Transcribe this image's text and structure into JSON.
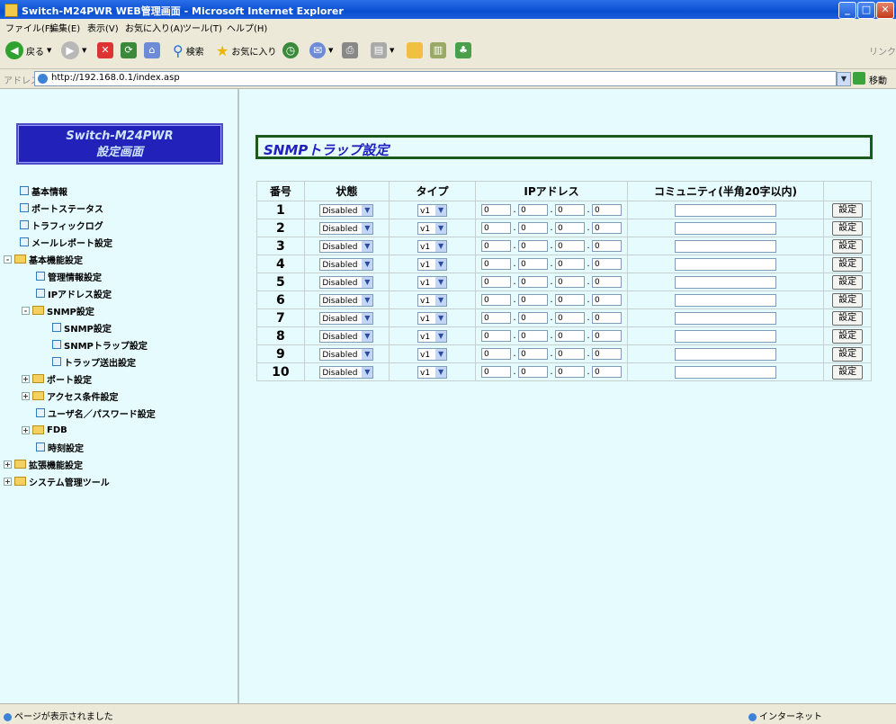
{
  "window": {
    "title": "Switch-M24PWR WEB管理画面 - Microsoft Internet Explorer",
    "minimize": "_",
    "maximize": "□",
    "close": "✕"
  },
  "menu": [
    "ファイル(F)",
    "編集(E)",
    "表示(V)",
    "お気に入り(A)",
    "ツール(T)",
    "ヘルプ(H)"
  ],
  "toolbar": {
    "back": "戻る",
    "search": "検索",
    "favorites": "お気に入り",
    "links": "リンク"
  },
  "address": {
    "label": "アドレス(D)",
    "url": "http://192.168.0.1/index.asp",
    "go": "移動"
  },
  "sidebar": {
    "logo_line1": "Switch-M24PWR",
    "logo_line2": "設定画面",
    "items": [
      {
        "label": "基本情報"
      },
      {
        "label": "ポートステータス"
      },
      {
        "label": "トラフィックログ"
      },
      {
        "label": "メールレポート設定"
      },
      {
        "label": "基本機能設定",
        "toggle": "-"
      },
      {
        "label": "管理情報設定"
      },
      {
        "label": "IPアドレス設定"
      },
      {
        "label": "SNMP設定",
        "toggle": "-"
      },
      {
        "label": "SNMP設定"
      },
      {
        "label": "SNMPトラップ設定"
      },
      {
        "label": "トラップ送出設定"
      },
      {
        "label": "ポート設定",
        "toggle": "+"
      },
      {
        "label": "アクセス条件設定",
        "toggle": "+"
      },
      {
        "label": "ユーザ名／パスワード設定"
      },
      {
        "label": "FDB",
        "toggle": "+"
      },
      {
        "label": "時刻設定"
      },
      {
        "label": "拡張機能設定",
        "toggle": "+"
      },
      {
        "label": "システム管理ツール",
        "toggle": "+"
      }
    ]
  },
  "page": {
    "title": "SNMPトラップ設定",
    "headers": [
      "番号",
      "状態",
      "タイプ",
      "IPアドレス",
      "コミュニティ(半角20字以内)"
    ],
    "rows": [
      {
        "no": "1",
        "status": "Disabled",
        "type": "v1",
        "ip": [
          "0",
          "0",
          "0",
          "0"
        ],
        "community": "",
        "button": "設定"
      },
      {
        "no": "2",
        "status": "Disabled",
        "type": "v1",
        "ip": [
          "0",
          "0",
          "0",
          "0"
        ],
        "community": "",
        "button": "設定"
      },
      {
        "no": "3",
        "status": "Disabled",
        "type": "v1",
        "ip": [
          "0",
          "0",
          "0",
          "0"
        ],
        "community": "",
        "button": "設定"
      },
      {
        "no": "4",
        "status": "Disabled",
        "type": "v1",
        "ip": [
          "0",
          "0",
          "0",
          "0"
        ],
        "community": "",
        "button": "設定"
      },
      {
        "no": "5",
        "status": "Disabled",
        "type": "v1",
        "ip": [
          "0",
          "0",
          "0",
          "0"
        ],
        "community": "",
        "button": "設定"
      },
      {
        "no": "6",
        "status": "Disabled",
        "type": "v1",
        "ip": [
          "0",
          "0",
          "0",
          "0"
        ],
        "community": "",
        "button": "設定"
      },
      {
        "no": "7",
        "status": "Disabled",
        "type": "v1",
        "ip": [
          "0",
          "0",
          "0",
          "0"
        ],
        "community": "",
        "button": "設定"
      },
      {
        "no": "8",
        "status": "Disabled",
        "type": "v1",
        "ip": [
          "0",
          "0",
          "0",
          "0"
        ],
        "community": "",
        "button": "設定"
      },
      {
        "no": "9",
        "status": "Disabled",
        "type": "v1",
        "ip": [
          "0",
          "0",
          "0",
          "0"
        ],
        "community": "",
        "button": "設定"
      },
      {
        "no": "10",
        "status": "Disabled",
        "type": "v1",
        "ip": [
          "0",
          "0",
          "0",
          "0"
        ],
        "community": "",
        "button": "設定"
      }
    ]
  },
  "status": {
    "left": "ページが表示されました",
    "zone": "インターネット"
  }
}
